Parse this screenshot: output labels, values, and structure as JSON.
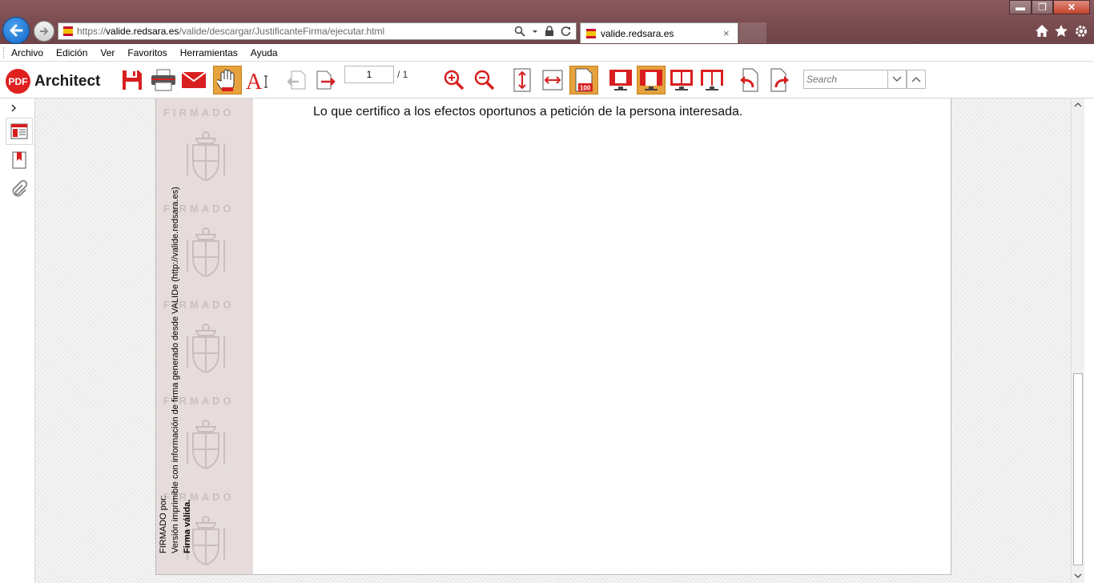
{
  "browser": {
    "url_prefix": "https://",
    "url_domain": "valide.redsara.es",
    "url_path": "/valide/descargar/JustificanteFirma/ejecutar.html",
    "tab_title": "valide.redsara.es",
    "tab_close": "×",
    "window_min": "▬",
    "window_max": "❐",
    "window_close": "✕"
  },
  "menu": {
    "items": [
      "Archivo",
      "Edición",
      "Ver",
      "Favoritos",
      "Herramientas",
      "Ayuda"
    ]
  },
  "toolbar": {
    "app_logo": "PDF",
    "app_name": "Architect",
    "page_current": "1",
    "page_total": "/  1",
    "search_placeholder": "Search",
    "active_color": "#e6a23c",
    "accent_color": "#e02020"
  },
  "document": {
    "certify_text": "Lo que certifico a los efectos oportunos a petición de la persona interesada.",
    "watermark": "FIRMADO",
    "side_line1": "FIRMADO por:",
    "side_line2": "Versión imprimible con información de firma generado desde VALIDe (http://valide.redsara.es)",
    "side_line3": "Firma válida."
  }
}
